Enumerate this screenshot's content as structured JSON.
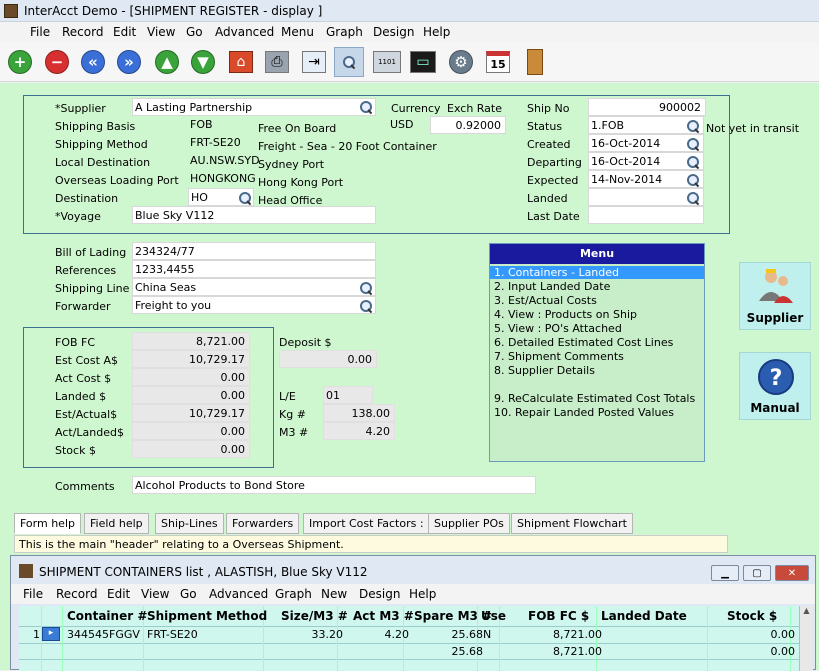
{
  "window": {
    "title": "InterAcct Demo - [SHIPMENT REGISTER - display ]"
  },
  "menubar": [
    "File",
    "Record",
    "Edit",
    "View",
    "Go",
    "Advanced",
    "Menu",
    "Graph",
    "Design",
    "Help"
  ],
  "toolbar": [
    "add-icon",
    "delete-icon",
    "first-icon",
    "last-icon",
    "up-icon",
    "down-icon",
    "home-icon",
    "print-icon",
    "export-icon",
    "search-icon",
    "binary-icon",
    "monitor-icon",
    "gear-icon",
    "calendar-icon",
    "door-icon"
  ],
  "calendar_day": "15",
  "header": {
    "supplier_label": "*Supplier",
    "supplier": "A Lasting Partnership",
    "shipping_basis_label": "Shipping Basis",
    "shipping_basis": "FOB",
    "shipping_basis_desc": "Free On Board",
    "shipping_method_label": "Shipping Method",
    "shipping_method": "FRT-SE20",
    "shipping_method_desc": "Freight - Sea - 20 Foot Container",
    "local_dest_label": "Local Destination",
    "local_dest": "AU.NSW.SYD",
    "local_dest_desc": "Sydney Port",
    "loading_port_label": "Overseas Loading Port",
    "loading_port": "HONGKONG",
    "loading_port_desc": "Hong Kong Port",
    "destination_label": "Destination",
    "destination": "HO",
    "destination_desc": "Head Office",
    "voyage_label": "*Voyage",
    "voyage": "Blue Sky V112",
    "currency_label": "Currency",
    "currency": "USD",
    "exch_rate_label": "Exch Rate",
    "exch_rate": "0.92000",
    "ship_no_label": "Ship No",
    "ship_no": "900002",
    "status_label": "Status",
    "status": "1.FOB",
    "status_desc": "Not yet in transit",
    "created_label": "Created",
    "created": "16-Oct-2014",
    "departing_label": "Departing",
    "departing": "16-Oct-2014",
    "expected_label": "Expected",
    "expected": "14-Nov-2014",
    "landed_label": "Landed",
    "landed": "",
    "last_date_label": "Last Date",
    "last_date": ""
  },
  "shipping": {
    "bill_label": "Bill of Lading",
    "bill": "234324/77",
    "refs_label": "References",
    "refs": "1233,4455",
    "line_label": "Shipping Line",
    "line": "China Seas",
    "forwarder_label": "Forwarder",
    "forwarder": "Freight to you"
  },
  "costs": {
    "fob_label": "FOB FC",
    "fob": "8,721.00",
    "est_label": "Est Cost A$",
    "est": "10,729.17",
    "act_label": "Act Cost $",
    "act": "0.00",
    "landed_label": "Landed $",
    "landed": "0.00",
    "est_act_label": "Est/Actual$",
    "est_act": "10,729.17",
    "act_landed_label": "Act/Landed$",
    "act_landed": "0.00",
    "stock_label": "Stock $",
    "stock": "0.00",
    "deposit_label": "Deposit $",
    "deposit": "0.00",
    "le_label": "L/E",
    "le": "01",
    "kg_label": "Kg #",
    "kg": "138.00",
    "m3_label": "M3 #",
    "m3": "4.20"
  },
  "comments": {
    "label": "Comments",
    "value": "Alcohol Products to Bond Store"
  },
  "menu": {
    "title": "Menu",
    "items": [
      "1. Containers - Landed",
      "2. Input Landed Date",
      "3. Est/Actual Costs",
      "4. View : Products on Ship",
      "5. View : PO's Attached",
      "6. Detailed Estimated Cost Lines",
      "7. Shipment Comments",
      "8. Supplier Details",
      "9. ReCalculate Estimated Cost Totals",
      "10. Repair Landed Posted Values"
    ]
  },
  "side": {
    "supplier": "Supplier",
    "manual": "Manual"
  },
  "tabs": [
    "Form help",
    "Field help",
    "Ship-Lines",
    "Forwarders",
    "Import Cost Factors :",
    "Supplier POs",
    "Shipment Flowchart"
  ],
  "help_text": "This is the main \"header\" relating to a Overseas Shipment.",
  "subwindow": {
    "title": "SHIPMENT CONTAINERS list , ALASTISH, Blue Sky V112",
    "menubar": [
      "File",
      "Record",
      "Edit",
      "View",
      "Go",
      "Advanced",
      "Graph",
      "New",
      "Design",
      "Help"
    ],
    "columns": [
      "Container #",
      "Shipment Method",
      "Size/M3 #",
      "Act M3 #",
      "Spare M3 #",
      "Use",
      "FOB FC $",
      "Landed Date",
      "Stock $"
    ],
    "rows": [
      {
        "num": "1",
        "container": "344545FGGV",
        "method": "FRT-SE20",
        "size": "33.20",
        "act": "4.20",
        "spare": "25.68",
        "use": "N",
        "fob": "8,721.00",
        "landed": "",
        "stock": "0.00"
      }
    ],
    "totals": {
      "spare": "25.68",
      "fob": "8,721.00",
      "stock": "0.00"
    }
  },
  "colors": {
    "form_bg": "#cff7cf",
    "menu_sel": "#3399ff",
    "menu_head": "#1a1a9e"
  }
}
